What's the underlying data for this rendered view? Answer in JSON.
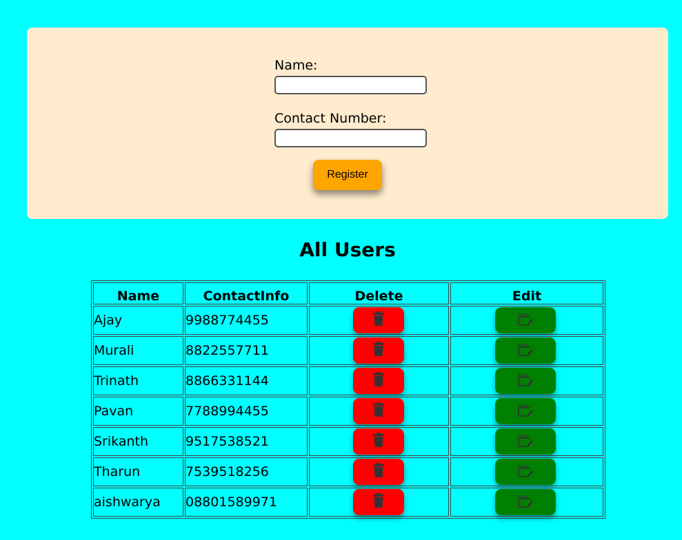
{
  "form": {
    "name_label": "Name:",
    "name_value": "",
    "contact_label": "Contact Number:",
    "contact_value": "",
    "register_label": "Register"
  },
  "users_section": {
    "title": "All Users",
    "columns": [
      "Name",
      "ContactInfo",
      "Delete",
      "Edit"
    ],
    "rows": [
      {
        "name": "Ajay",
        "contact": "9988774455"
      },
      {
        "name": "Murali",
        "contact": "8822557711"
      },
      {
        "name": "Trinath",
        "contact": "8866331144"
      },
      {
        "name": "Pavan",
        "contact": "7788994455"
      },
      {
        "name": "Srikanth",
        "contact": "9517538521"
      },
      {
        "name": "Tharun",
        "contact": "7539518256"
      },
      {
        "name": "aishwarya",
        "contact": "08801589971"
      }
    ],
    "delete_icon": "trash-icon",
    "edit_icon": "edit-icon"
  },
  "colors": {
    "page_background": "#00ffff",
    "form_background": "#ffebcd",
    "register_button": "#ffa500",
    "delete_button": "#ff0000",
    "edit_button": "#008000",
    "icon": "#333333"
  }
}
